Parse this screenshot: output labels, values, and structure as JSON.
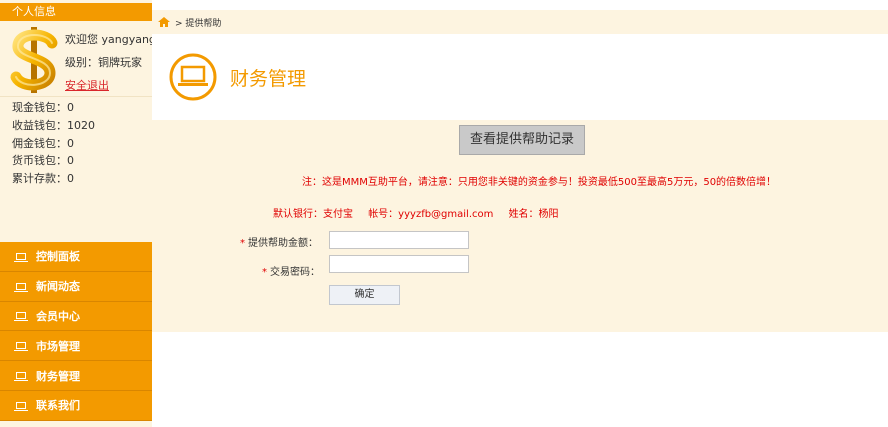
{
  "sidebar": {
    "header": "个人信息",
    "welcome": "欢迎您 yangyang",
    "level": "级别：铜牌玩家",
    "logout": "安全退出",
    "wallets": [
      "现金钱包：0",
      "收益钱包：1020",
      "佣金钱包：0",
      "货币钱包：0",
      "累计存款：0"
    ],
    "menu": [
      "控制面板",
      "新闻动态",
      "会员中心",
      "市场管理",
      "财务管理",
      "联系我们"
    ]
  },
  "breadcrumb": "> 提供帮助",
  "page_title": "财务管理",
  "content": {
    "records_button": "查看提供帮助记录",
    "notice": "注：这是MMM互助平台，请注意：只用您非关键的资金参与！投资最低500至最高5万元，50的倍数倍增！",
    "bank": {
      "default_bank": "默认银行：支付宝",
      "account": "帐号：yyyzfb@gmail.com",
      "name": "姓名：杨阳"
    },
    "form": {
      "amount_label": "提供帮助金额：",
      "password_label": "交易密码：",
      "required_mark": "*",
      "amount_value": "",
      "password_value": "",
      "submit": "确定"
    }
  },
  "colors": {
    "accent": "#f39a00",
    "panel_bg": "#fdf4e0",
    "notice": "#e00000"
  }
}
